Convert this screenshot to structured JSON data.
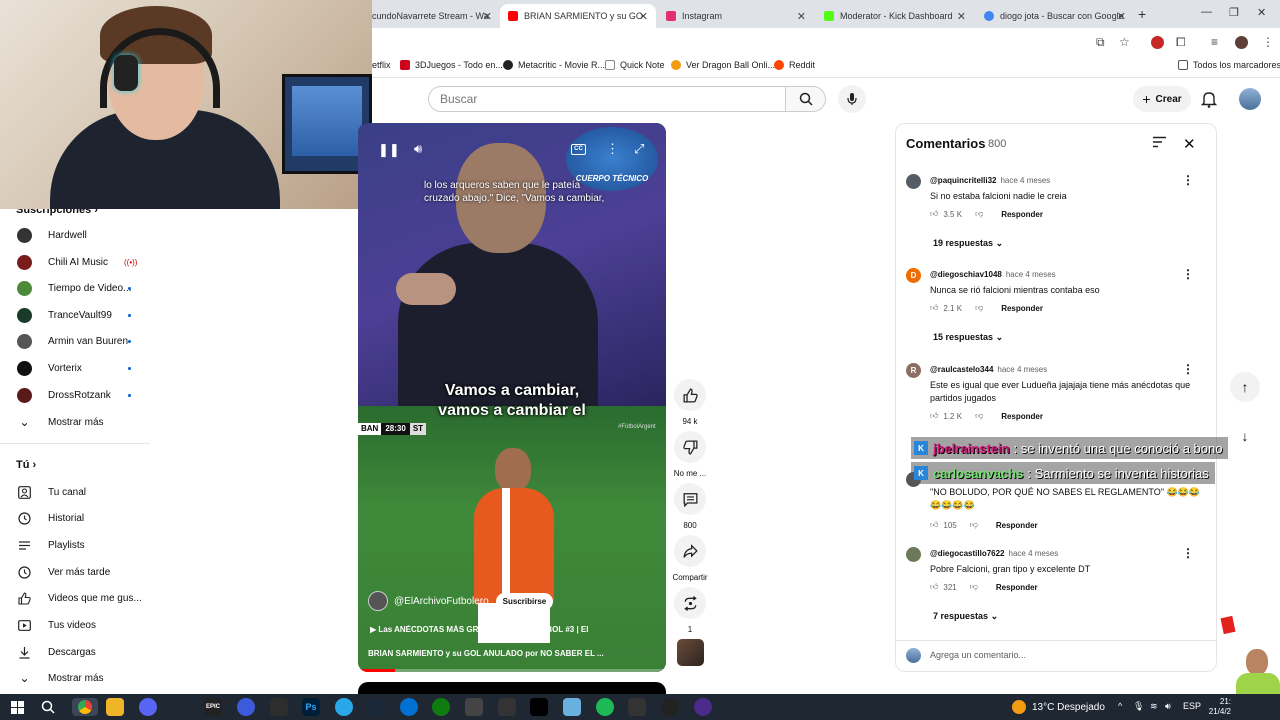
{
  "browser": {
    "tabs": [
      {
        "title": "cundoNavarrete Stream - Wa",
        "color": "#9146ff"
      },
      {
        "title": "BRIAN SARMIENTO y su GO",
        "color": "#ff0000"
      },
      {
        "title": "Instagram",
        "color": "#e1306c"
      },
      {
        "title": "Moderator - Kick Dashboard",
        "color": "#53fc18"
      },
      {
        "title": "diogo jota - Buscar con Google",
        "color": "#4285f4"
      }
    ],
    "bookmarks": [
      {
        "label": "etflix",
        "color": "#e50914"
      },
      {
        "label": "3DJuegos - Todo en...",
        "color": "#d0021b"
      },
      {
        "label": "Metacritic - Movie R...",
        "color": "#222222"
      },
      {
        "label": "Quick Note",
        "color": "#888888"
      },
      {
        "label": "Ver Dragon Ball Onli...",
        "color": "#f39c12"
      },
      {
        "label": "Reddit",
        "color": "#ff4500"
      }
    ],
    "all_bookmarks": "Todos los marcadores"
  },
  "header": {
    "search_placeholder": "Buscar",
    "create_label": "Crear"
  },
  "sidebar": {
    "subscriptions_heading": "Suscripciones",
    "subscriptions": [
      {
        "label": "Hardwell",
        "color": "#333333",
        "status": ""
      },
      {
        "label": "Chili AI Music",
        "color": "#7a1c1c",
        "status": "live"
      },
      {
        "label": "Tiempo de Video...",
        "color": "#4c8a3a",
        "status": "new"
      },
      {
        "label": "TranceVault99",
        "color": "#1a3a2a",
        "status": "new"
      },
      {
        "label": "Armin van Buuren",
        "color": "#555555",
        "status": "new"
      },
      {
        "label": "Vorterix",
        "color": "#111111",
        "status": "new"
      },
      {
        "label": "DrossRotzank",
        "color": "#5a1a1a",
        "status": "new"
      }
    ],
    "show_more": "Mostrar más",
    "you_heading": "Tú",
    "you_items": [
      {
        "label": "Tu canal",
        "icon": "channel-icon"
      },
      {
        "label": "Historial",
        "icon": "history-icon"
      },
      {
        "label": "Playlists",
        "icon": "playlist-icon"
      },
      {
        "label": "Ver más tarde",
        "icon": "clock-icon"
      },
      {
        "label": "Videos que me gus...",
        "icon": "like-icon"
      },
      {
        "label": "Tus videos",
        "icon": "video-icon"
      },
      {
        "label": "Descargas",
        "icon": "download-icon"
      }
    ],
    "show_more_2": "Mostrar más"
  },
  "short": {
    "cc_caption": "lo los arqueros saben que le pateía cruzado abajo.\" Dice, \"Vamos a cambiar,",
    "logo_text": "CUERPO TÉCNICO",
    "burned_caption_1": "Vamos a cambiar,",
    "burned_caption_2": "vamos a cambiar el",
    "scorebug_team": "BAN",
    "scorebug_time": "28:30",
    "scorebug_tag": "ST",
    "hashtag": "#FútbolArgent",
    "channel": "@ElArchivoFutbolero",
    "subscribe": "Suscribirse",
    "title_line1": "Las ANÉCDOTAS MÁS GRACIOSAS del FÚTBOL #3 | El",
    "title_line2": "BRIAN SARMIENTO y su GOL ANULADO por NO SABER EL ...",
    "progress": 0.12
  },
  "actions": {
    "likes": "94 k",
    "dislike": "No me ...",
    "comments": "800",
    "share": "Compartir",
    "remix": "1"
  },
  "comments": {
    "title": "Comentarios",
    "count": "800",
    "items": [
      {
        "user": "@paquincritelli32",
        "time": "hace 4 meses",
        "text": "Si no estaba falcioni nadie le creia",
        "likes": "3.5 K",
        "replies": "19 respuestas",
        "avatar": "",
        "color": "#555c66"
      },
      {
        "user": "@diegoschiav1048",
        "time": "hace 4 meses",
        "text": "Nunca se rió falcioni mientras contaba eso",
        "likes": "2.1 K",
        "replies": "15 respuestas",
        "avatar": "D",
        "color": "#ef6c00"
      },
      {
        "user": "@raulcastelo344",
        "time": "hace 4 meses",
        "text": "Este es igual que ever Ludueña jajajaja tiene más anécdotas que partidos jugados",
        "likes": "1.2 K",
        "replies": "",
        "avatar": "R",
        "color": "#8d6e63"
      },
      {
        "user": "",
        "time": "",
        "text": "\"NO BOLUDO, POR QUÉ NO SABES EL REGLAMENTO\" 😂😂😂 😂😂😂😂",
        "likes": "105",
        "replies": "",
        "avatar": "",
        "color": "#555555"
      },
      {
        "user": "@diegocastillo7622",
        "time": "hace 4 meses",
        "text": "Pobre Falcioni, gran tipo y excelente DT",
        "likes": "321",
        "replies": "7 respuestas",
        "avatar": "",
        "color": "#6d7a5a"
      }
    ],
    "reply_label": "Responder",
    "add_placeholder": "Agrega un comentario..."
  },
  "chat": [
    {
      "user": "jbelrainstein",
      "message": ": se inventó una que conoció a bono"
    },
    {
      "user": "carlosanvachs",
      "message": ": Sarmiento se inventa historias"
    }
  ],
  "taskbar": {
    "weather": "13°C  Despejado",
    "lang": "ESP",
    "time": "21:",
    "date": "21/4/2"
  }
}
